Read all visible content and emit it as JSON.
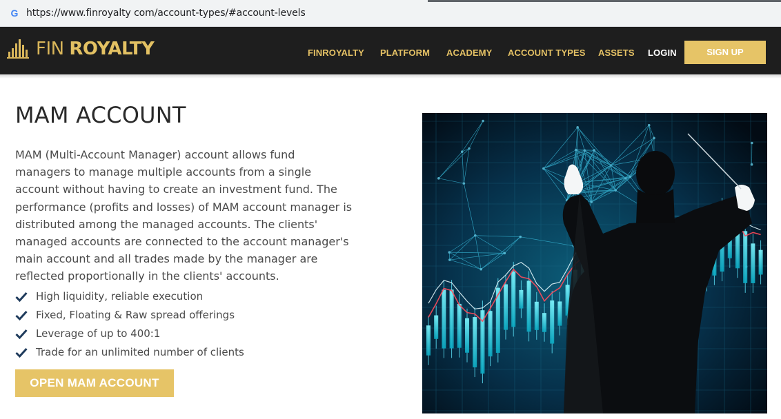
{
  "browser": {
    "url": "https://www.finroyalty com/account-types/#account-levels",
    "favicon_icon": "google-g-icon"
  },
  "header": {
    "logo": {
      "fin": "FIN",
      "royalty": "ROYALTY",
      "icon": "columns-bars-icon"
    },
    "menu": [
      {
        "label": "FINROYALTY"
      },
      {
        "label": "PLATFORM"
      },
      {
        "label": "ACADEMY"
      },
      {
        "label": "ACCOUNT TYPES"
      },
      {
        "label": "ASSETS"
      },
      {
        "label": "LOGIN"
      }
    ],
    "signup_label": "SIGN UP"
  },
  "main": {
    "title": "MAM ACCOUNT",
    "description": "MAM (Multi-Account Manager) account allows fund managers to manage multiple accounts from a single account without having to create an investment fund. The performance (profits and losses) of MAM account manager is distributed among the managed accounts. The clients' managed accounts are connected to the account manager's main account and all trades made by the manager are reflected proportionally in the clients' accounts.",
    "features": [
      {
        "text": "High liquidity, reliable execution",
        "icon": "checkmark-icon"
      },
      {
        "text": "Fixed, Floating & Raw spread offerings",
        "icon": "checkmark-icon"
      },
      {
        "text": "Leverage of up to 400:1",
        "icon": "checkmark-icon"
      },
      {
        "text": "Trade for an unlimited number of clients",
        "icon": "checkmark-icon"
      }
    ],
    "cta_label": "OPEN MAM ACCOUNT"
  },
  "colors": {
    "nav_bg": "#1e1e1e",
    "gold": "#e6c467",
    "checkmark": "#1f3b5c",
    "text": "#4a4a4a"
  }
}
